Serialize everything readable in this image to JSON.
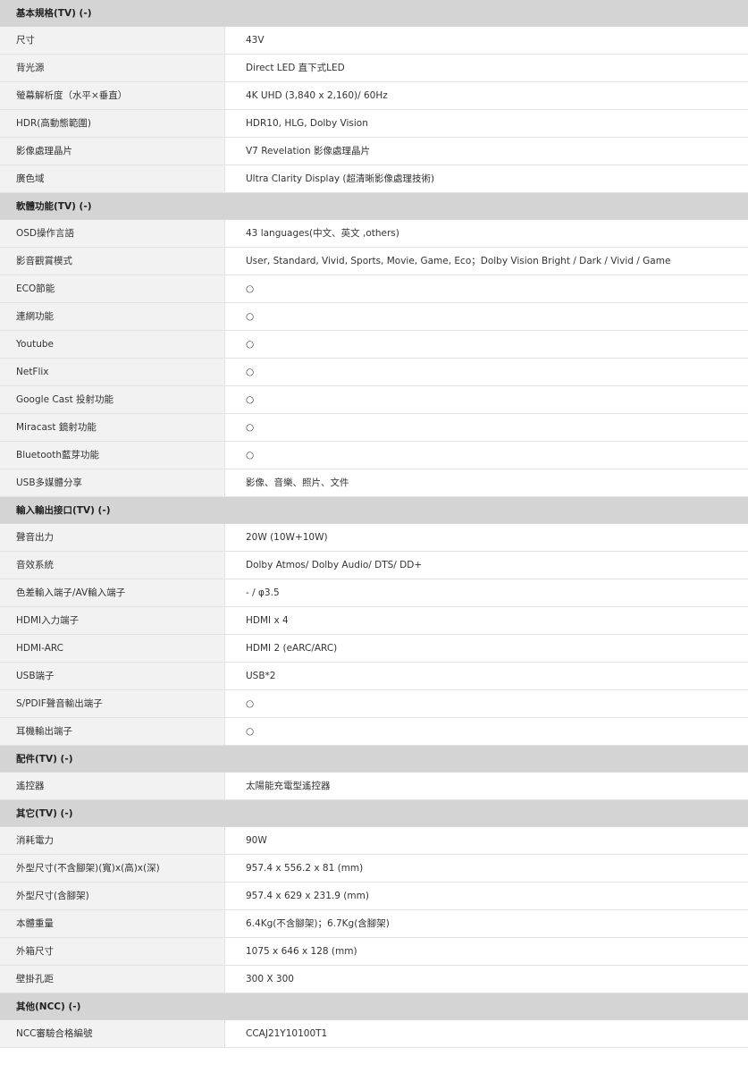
{
  "sections": [
    {
      "title": "基本規格(TV) (-)",
      "rows": [
        {
          "label": "尺寸",
          "value": "43V"
        },
        {
          "label": "背光源",
          "value": "Direct LED 直下式LED"
        },
        {
          "label": "螢幕解析度（水平×垂直）",
          "value": "4K UHD (3,840 x 2,160)/ 60Hz"
        },
        {
          "label": "HDR(高動態範圍)",
          "value": "HDR10, HLG, Dolby Vision"
        },
        {
          "label": "影像處理晶片",
          "value": "V7 Revelation 影像處理晶片"
        },
        {
          "label": "廣色域",
          "value": "Ultra Clarity Display (超清晰影像處理技術)"
        }
      ]
    },
    {
      "title": "軟體功能(TV) (-)",
      "rows": [
        {
          "label": "OSD操作言語",
          "value": "43 languages(中文、英文 ,others)"
        },
        {
          "label": "影音觀賞模式",
          "value": "User, Standard, Vivid, Sports, Movie, Game, Eco；Dolby Vision Bright / Dark / Vivid / Game"
        },
        {
          "label": "ECO節能",
          "value": "○"
        },
        {
          "label": "連網功能",
          "value": "○"
        },
        {
          "label": "Youtube",
          "value": "○"
        },
        {
          "label": "NetFlix",
          "value": "○"
        },
        {
          "label": "Google Cast 投射功能",
          "value": "○"
        },
        {
          "label": "Miracast 鏡射功能",
          "value": "○"
        },
        {
          "label": "Bluetooth藍芽功能",
          "value": "○"
        },
        {
          "label": "USB多媒體分享",
          "value": "影像、音樂、照片、文件"
        }
      ]
    },
    {
      "title": "輸入輸出接口(TV) (-)",
      "rows": [
        {
          "label": "聲音出力",
          "value": "20W (10W+10W)"
        },
        {
          "label": "音效系統",
          "value": "Dolby Atmos/ Dolby Audio/ DTS/ DD+"
        },
        {
          "label": "色差輸入端子/AV輸入端子",
          "value": "- / φ3.5"
        },
        {
          "label": "HDMI入力端子",
          "value": "HDMI x 4"
        },
        {
          "label": "HDMI-ARC",
          "value": "HDMI 2 (eARC/ARC)"
        },
        {
          "label": "USB端子",
          "value": "USB*2"
        },
        {
          "label": "S/PDIF聲音輸出端子",
          "value": "○"
        },
        {
          "label": "耳機輸出端子",
          "value": "○"
        }
      ]
    },
    {
      "title": "配件(TV) (-)",
      "rows": [
        {
          "label": "遙控器",
          "value": "太陽能充電型遙控器"
        }
      ]
    },
    {
      "title": "其它(TV) (-)",
      "rows": [
        {
          "label": "消耗電力",
          "value": "90W"
        },
        {
          "label": "外型尺寸(不含腳架)(寬)x(高)x(深)",
          "value": "957.4 x 556.2 x 81 (mm)"
        },
        {
          "label": "外型尺寸(含腳架)",
          "value": "957.4 x 629 x 231.9 (mm)"
        },
        {
          "label": "本體重量",
          "value": "6.4Kg(不含腳架)；6.7Kg(含腳架)"
        },
        {
          "label": "外箱尺寸",
          "value": "1075 x 646 x 128 (mm)"
        },
        {
          "label": "壁掛孔距",
          "value": "300 X 300"
        }
      ]
    },
    {
      "title": "其他(NCC) (-)",
      "rows": [
        {
          "label": "NCC審驗合格編號",
          "value": "CCAJ21Y10100T1"
        }
      ]
    }
  ]
}
